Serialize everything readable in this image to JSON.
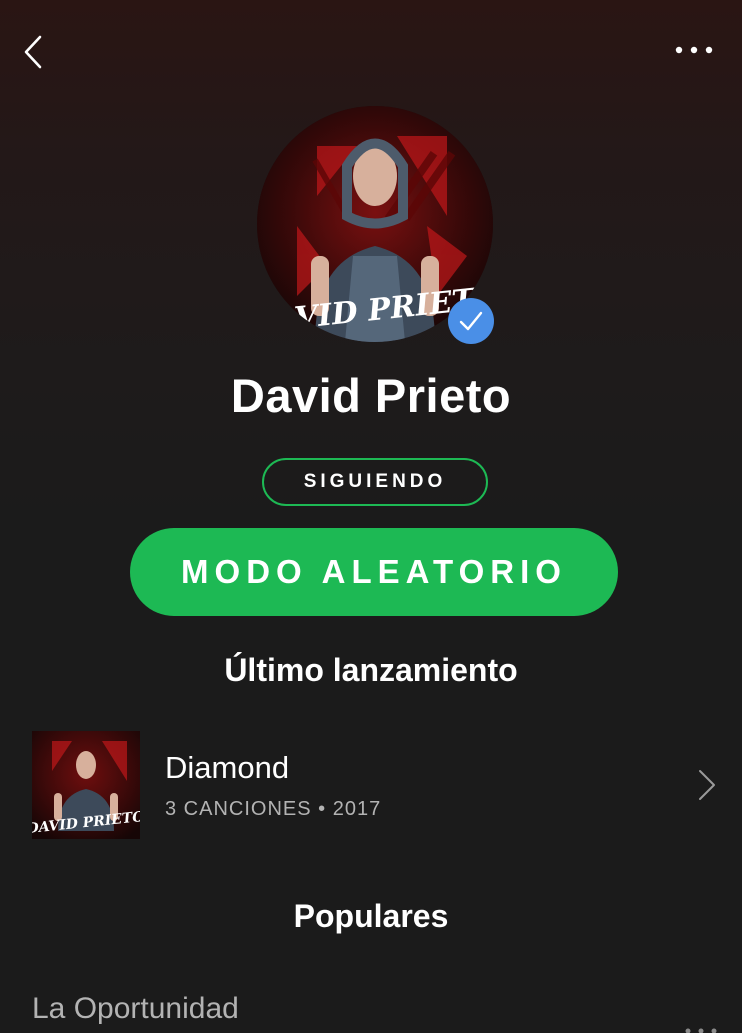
{
  "header": {
    "back_icon": "chevron-left-icon",
    "more_icon": "more-horizontal-icon"
  },
  "artist": {
    "name": "David Prieto",
    "logo_text": "DAVID PRIETO",
    "verified": true,
    "verified_color": "#4a8fe7"
  },
  "actions": {
    "follow_label": "SIGUIENDO",
    "shuffle_label": "MODO ALEATORIO",
    "accent_color": "#1db954"
  },
  "latest_release": {
    "section_title": "Último lanzamiento",
    "title": "Diamond",
    "meta": "3 CANCIONES • 2017",
    "cover_logo_text": "DAVID PRIETO"
  },
  "popular": {
    "section_title": "Populares",
    "tracks": [
      {
        "title": "La Oportunidad"
      }
    ]
  }
}
